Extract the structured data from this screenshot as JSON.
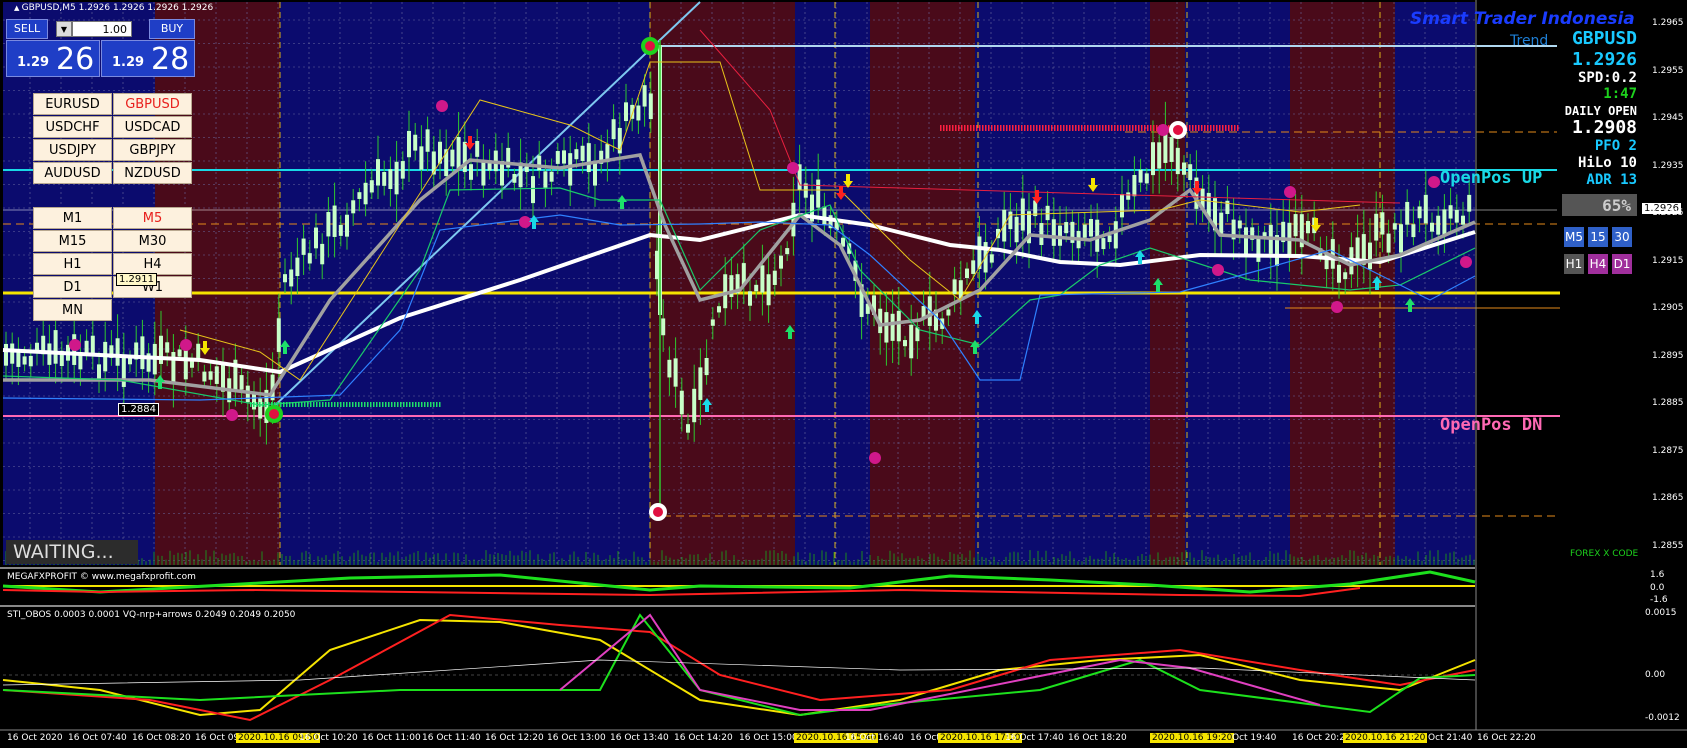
{
  "chart_header": {
    "symbol_info": "GBPUSD,M5  1.2926 1.2926 1.2926 1.2926"
  },
  "watermark": "Smart Trader Indonesia",
  "trend_label": "Trend",
  "footer_brand": "FOREX X CODE",
  "trade_panel": {
    "sell_label": "SELL",
    "buy_label": "BUY",
    "lot": "1.00",
    "sell_small": "1.29",
    "sell_big": "26",
    "buy_small": "1.29",
    "buy_big": "28"
  },
  "symbols": [
    "EURUSD",
    "GBPUSD",
    "USDCHF",
    "USDCAD",
    "USDJPY",
    "GBPJPY",
    "AUDUSD",
    "NZDUSD"
  ],
  "active_symbol": "GBPUSD",
  "timeframes": [
    "M1",
    "M5",
    "M15",
    "M30",
    "H1",
    "H4",
    "D1",
    "W1",
    "MN"
  ],
  "active_timeframe": "M5",
  "info": {
    "symbol": "GBPUSD",
    "price": "1.2926",
    "spread": "SPD:0.2",
    "timer": "1:47",
    "daily_open_label": "DAILY OPEN",
    "daily_open": "1.2908",
    "pfo": "PFO   2",
    "hilo": "HiLo  10",
    "adr": "ADR  13",
    "percent": "65%",
    "tf_buttons": [
      "M5",
      "15",
      "30",
      "H1",
      "H4",
      "D1"
    ]
  },
  "labels": {
    "openpos_up": "OpenPos UP",
    "openpos_dn": "OpenPos DN",
    "price_tag_1": "1.2911",
    "price_tag_2": "1.2884",
    "current_price_tag": "1.2926",
    "waiting": "WAITING..."
  },
  "price_axis": [
    "1.2965",
    "1.2955",
    "1.2945",
    "1.2935",
    "1.2925",
    "1.2915",
    "1.2905",
    "1.2895",
    "1.2885",
    "1.2875",
    "1.2865",
    "1.2855"
  ],
  "sub1": {
    "title": "MEGAFXPROFIT © www.megafxprofit.com",
    "axis": [
      "1.6",
      "0.0",
      "-1.6"
    ]
  },
  "sub2": {
    "title": "STI_OBOS 0.0003 0.0001  VQ-nrp+arrows 0.2049 0.2049 0.2050",
    "axis": [
      "0.0015",
      "0.00",
      "-0.0012"
    ]
  },
  "time_axis": [
    "16 Oct 2020",
    "16 Oct 07:40",
    "16 Oct 08:20",
    "16 Oct 09",
    "2020.10.16 09:50",
    "16 Oct 10:20",
    "16 Oct 11:00",
    "16 Oct 11:40",
    "16 Oct 12:20",
    "16 Oct 13:00",
    "16 Oct 13:40",
    "16 Oct 14:20",
    "16 Oct 15:00",
    "2020.10.16 15:40",
    "16 Oct 16:40",
    "16 Oct",
    "2020.10.16 17:10",
    "16 Oct 17:40",
    "16 Oct 18:20",
    "2020.10.16 19:20",
    "Oct 19:40",
    "16 Oct 20:20",
    "2020.10.16 21:20",
    "Oct 21:40",
    "16 Oct 22:20"
  ],
  "colors": {
    "blue_zone": "#0b0b6e",
    "red_zone": "#4a0a1a",
    "ma_white": "#ffffff",
    "ma_gray": "#a0a0a0",
    "openpos_up": "#19d9e6",
    "openpos_dn": "#ff69b4",
    "yellow_line": "#f5e400",
    "candle": "#c8ffc8"
  }
}
